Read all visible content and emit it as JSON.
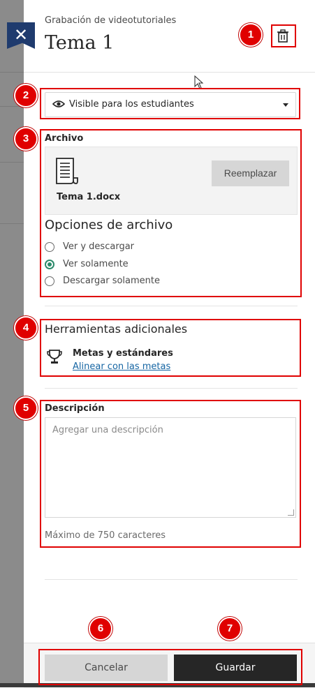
{
  "header": {
    "subtitle": "Grabación de videotutoriales",
    "title": "Tema 1",
    "close_icon": "close-icon",
    "delete_icon": "trash-icon"
  },
  "visibility": {
    "selected": "Visible para los estudiantes",
    "icon": "eye-icon"
  },
  "file": {
    "section_label": "Archivo",
    "file_name": "Tema 1.docx",
    "replace_label": "Reemplazar",
    "options_title": "Opciones de archivo",
    "options": [
      {
        "label": "Ver y descargar",
        "selected": false
      },
      {
        "label": "Ver solamente",
        "selected": true
      },
      {
        "label": "Descargar solamente",
        "selected": false
      }
    ]
  },
  "tools": {
    "title": "Herramientas adicionales",
    "goal_name": "Metas y estándares",
    "goal_link": "Alinear con las metas"
  },
  "description": {
    "label": "Descripción",
    "placeholder": "Agregar una descripción",
    "hint": "Máximo de 750 caracteres"
  },
  "footer": {
    "cancel_label": "Cancelar",
    "save_label": "Guardar"
  },
  "annotations": [
    "1",
    "2",
    "3",
    "4",
    "5",
    "6",
    "7"
  ],
  "colors": {
    "highlight": "#e00000",
    "accent_radio": "#2b8a6a",
    "link": "#1565a3",
    "close_button": "#1f3b6e"
  }
}
